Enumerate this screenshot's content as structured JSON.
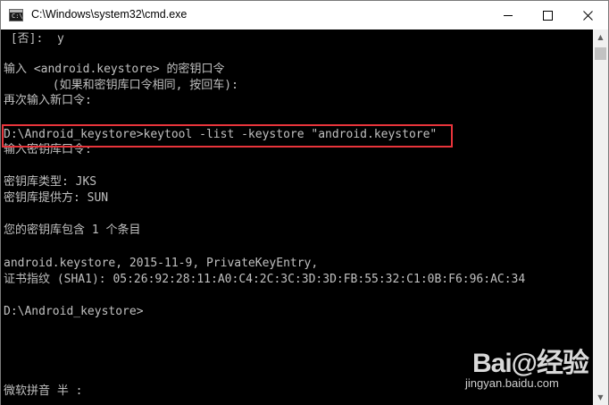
{
  "window": {
    "title": "C:\\Windows\\system32\\cmd.exe",
    "icon": "cmd-icon",
    "buttons": {
      "minimize": "minimize-icon",
      "maximize": "maximize-icon",
      "close": "close-icon"
    }
  },
  "console": {
    "lines": [
      " [否]:  y",
      "",
      "输入 <android.keystore> 的密钥口令",
      "       (如果和密钥库口令相同, 按回车):",
      "再次输入新口令:",
      "",
      "D:\\Android_keystore>keytool -list -keystore \"android.keystore\"",
      "输入密钥库口令:",
      "",
      "密钥库类型: JKS",
      "密钥库提供方: SUN",
      "",
      "您的密钥库包含 1 个条目",
      "",
      "android.keystore, 2015-11-9, PrivateKeyEntry,",
      "证书指纹 (SHA1): 05:26:92:28:11:A0:C4:2C:3C:3D:3D:FB:55:32:C1:0B:F6:96:AC:34",
      "",
      "D:\\Android_keystore>",
      "",
      "",
      "",
      "",
      "微软拼音 半 :"
    ]
  },
  "watermark": {
    "logo": "Bai@经验",
    "url": "jingyan.baidu.com"
  },
  "colors": {
    "console_bg": "#000000",
    "console_text": "#c0c0c0",
    "highlight": "#e8343b"
  }
}
